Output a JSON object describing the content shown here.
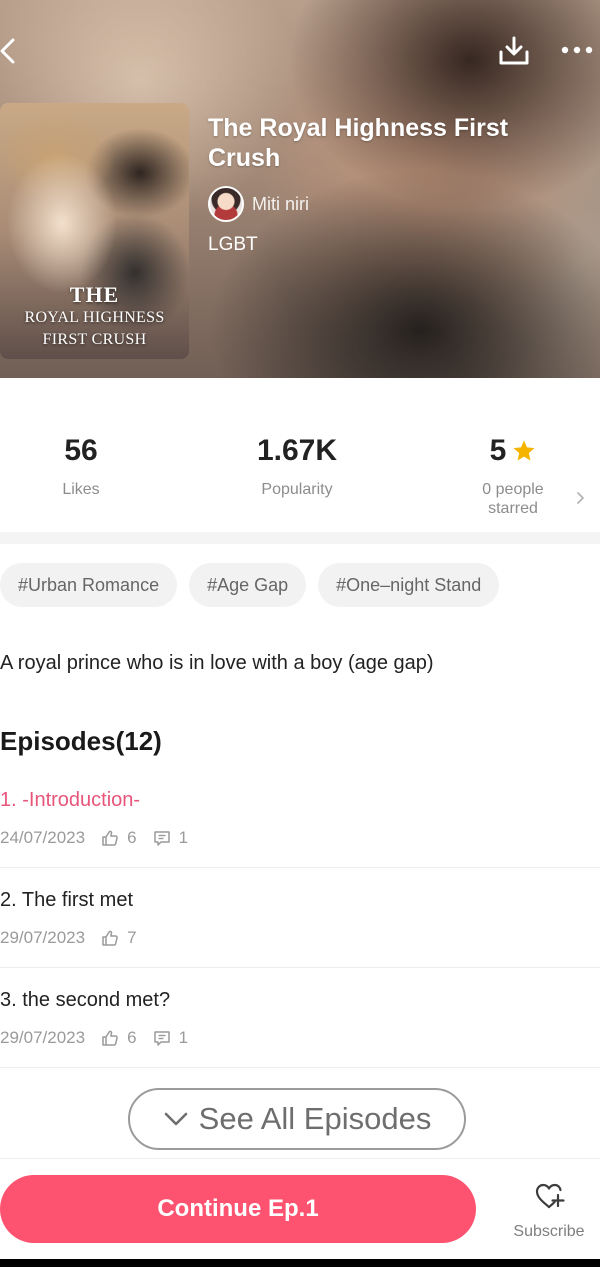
{
  "book": {
    "title": "The Royal Highness First Crush",
    "author": "Miti niri",
    "genre": "LGBT",
    "cover_text": {
      "word1": "THE",
      "line2": "ROYAL HIGHNESS",
      "line3": "FIRST CRUSH"
    }
  },
  "header": {
    "back_icon": "chevron-left-icon",
    "download_icon": "download-icon",
    "more_icon": "more-dots-icon"
  },
  "stats": {
    "likes": {
      "value": "56",
      "label": "Likes"
    },
    "popularity": {
      "value": "1.67K",
      "label": "Popularity"
    },
    "rating": {
      "value": "5",
      "label_line1": "0 people",
      "label_line2": "starred",
      "star_color": "#f5b400"
    }
  },
  "tags": [
    "#Urban Romance",
    "#Age Gap",
    "#One–night Stand"
  ],
  "synopsis": "A royal prince who is in love with a boy (age gap)",
  "episodes_heading": "Episodes(12)",
  "episodes": [
    {
      "title": "1. -Introduction-",
      "date": "24/07/2023",
      "likes": "6",
      "comments": "1",
      "current": true
    },
    {
      "title": "2. The first met",
      "date": "29/07/2023",
      "likes": "7",
      "comments": null,
      "current": false
    },
    {
      "title": "3. the second met?",
      "date": "29/07/2023",
      "likes": "6",
      "comments": "1",
      "current": false
    }
  ],
  "see_all_label": "See All Episodes",
  "bottom": {
    "continue_label": "Continue Ep.1",
    "subscribe_label": "Subscribe"
  },
  "colors": {
    "accent": "#fe5370",
    "current_episode": "#e8557a",
    "star": "#f5b400"
  }
}
